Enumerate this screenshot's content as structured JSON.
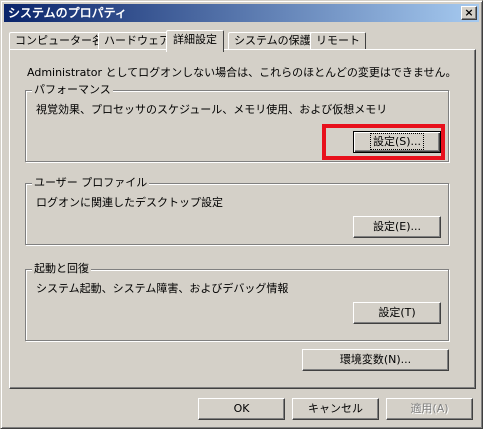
{
  "window": {
    "title": "システムのプロパティ",
    "close_symbol": "×"
  },
  "tabs": [
    {
      "label": "コンピューター名"
    },
    {
      "label": "ハードウェア"
    },
    {
      "label": "詳細設定",
      "active": true
    },
    {
      "label": "システムの保護"
    },
    {
      "label": "リモート"
    }
  ],
  "notice": "Administrator としてログオンしない場合は、これらのほとんどの変更はできません。",
  "performance": {
    "title": "パフォーマンス",
    "description": "視覚効果、プロセッサのスケジュール、メモリ使用、および仮想メモリ",
    "button": "設定(S)..."
  },
  "user_profile": {
    "title": "ユーザー プロファイル",
    "description": "ログオンに関連したデスクトップ設定",
    "button": "設定(E)..."
  },
  "startup_recovery": {
    "title": "起動と回復",
    "description": "システム起動、システム障害、およびデバッグ情報",
    "button": "設定(T)"
  },
  "env_button": "環境変数(N)...",
  "footer": {
    "ok": "OK",
    "cancel": "キャンセル",
    "apply": "適用(A)"
  },
  "colors": {
    "highlight": "#e8101c",
    "titlebar": "#0a246a"
  }
}
